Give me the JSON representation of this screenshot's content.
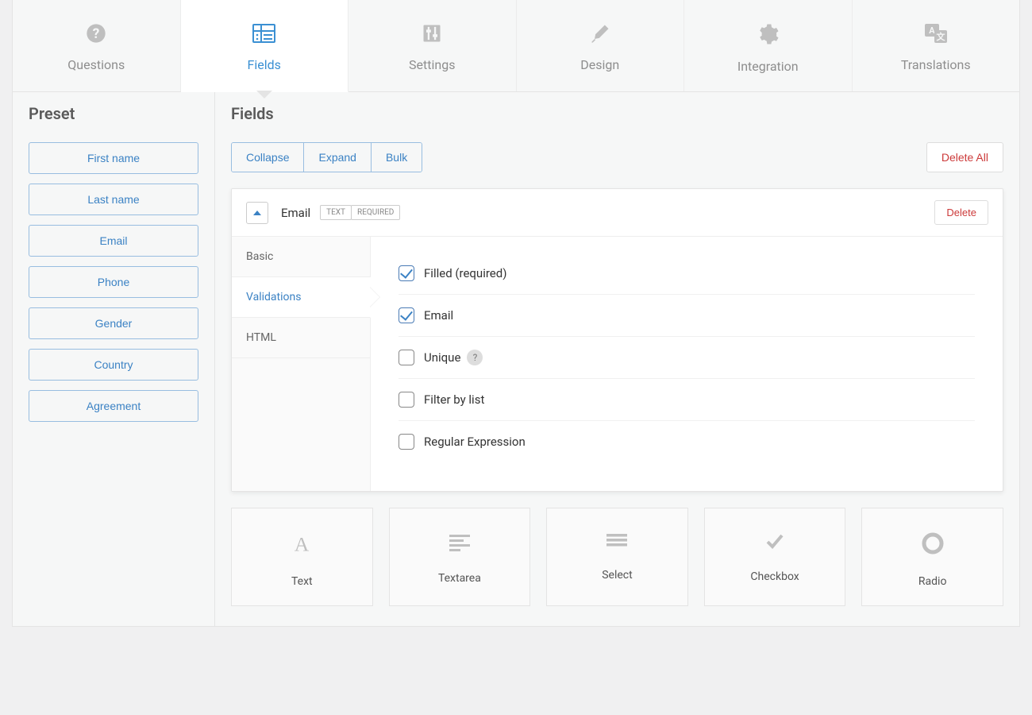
{
  "tabs": [
    {
      "id": "questions",
      "label": "Questions"
    },
    {
      "id": "fields",
      "label": "Fields"
    },
    {
      "id": "settings",
      "label": "Settings"
    },
    {
      "id": "design",
      "label": "Design"
    },
    {
      "id": "integration",
      "label": "Integration"
    },
    {
      "id": "translations",
      "label": "Translations"
    }
  ],
  "active_tab": "fields",
  "sidebar": {
    "title": "Preset",
    "presets": [
      "First name",
      "Last name",
      "Email",
      "Phone",
      "Gender",
      "Country",
      "Agreement"
    ]
  },
  "content": {
    "title": "Fields",
    "actions": {
      "collapse": "Collapse",
      "expand": "Expand",
      "bulk": "Bulk",
      "delete_all": "Delete All"
    }
  },
  "field": {
    "name": "Email",
    "badges": [
      "TEXT",
      "REQUIRED"
    ],
    "delete_label": "Delete",
    "subtabs": [
      "Basic",
      "Validations",
      "HTML"
    ],
    "active_subtab": "Validations",
    "validations": [
      {
        "label": "Filled (required)",
        "checked": true,
        "help": false
      },
      {
        "label": "Email",
        "checked": true,
        "help": false
      },
      {
        "label": "Unique",
        "checked": false,
        "help": true
      },
      {
        "label": "Filter by list",
        "checked": false,
        "help": false
      },
      {
        "label": "Regular Expression",
        "checked": false,
        "help": false
      }
    ]
  },
  "field_types": [
    "Text",
    "Textarea",
    "Select",
    "Checkbox",
    "Radio"
  ],
  "colors": {
    "accent": "#3b82c4",
    "icon": "#bfbfbf"
  }
}
